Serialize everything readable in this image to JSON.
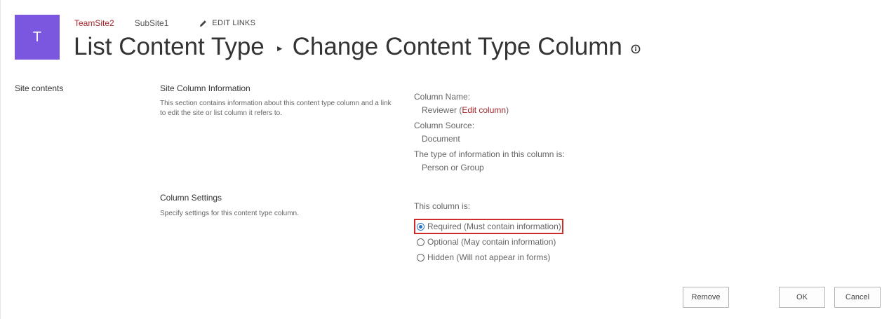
{
  "site": {
    "logo_letter": "T",
    "logo_color": "#7b57e0"
  },
  "top_nav": {
    "site_link": "TeamSite2",
    "subsite_link": "SubSite1",
    "edit_links": "EDIT LINKS"
  },
  "page": {
    "breadcrumb_parent": "List Content Type",
    "breadcrumb_current": "Change Content Type Column"
  },
  "left_nav": {
    "site_contents": "Site contents"
  },
  "site_column_info": {
    "title": "Site Column Information",
    "description": "This section contains information about this content type column and a link to edit the site or list column it refers to.",
    "column_name_label": "Column Name:",
    "column_name_value": "Reviewer",
    "edit_column_link": "Edit column",
    "column_source_label": "Column Source:",
    "column_source_value": "Document",
    "type_label": "The type of information in this column is:",
    "type_value": "Person or Group"
  },
  "column_settings": {
    "title": "Column Settings",
    "description": "Specify settings for this content type column.",
    "prompt": "This column is:",
    "options": [
      {
        "label": "Required (Must contain information)",
        "checked": true
      },
      {
        "label": "Optional (May contain information)",
        "checked": false
      },
      {
        "label": "Hidden (Will not appear in forms)",
        "checked": false
      }
    ]
  },
  "buttons": {
    "remove": "Remove",
    "ok": "OK",
    "cancel": "Cancel"
  },
  "colors": {
    "accent_link": "#a4262c",
    "highlight": "#d02b2b",
    "radio_selected": "#2b73c4"
  }
}
